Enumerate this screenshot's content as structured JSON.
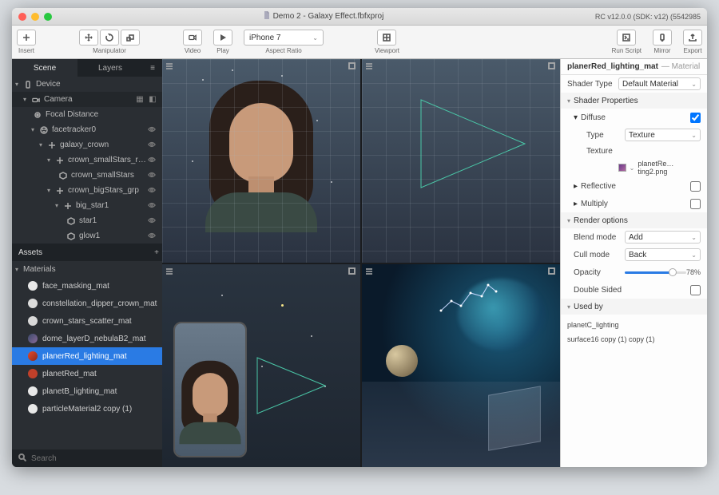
{
  "window": {
    "title": "Demo 2 - Galaxy Effect.fbfxproj",
    "version": "RC v12.0.0 (SDK: v12) (5542985"
  },
  "toolbar": {
    "insert": "Insert",
    "manipulator": "Manipulator",
    "video": "Video",
    "play": "Play",
    "aspect": "Aspect Ratio",
    "device_sel": "iPhone 7",
    "viewport": "Viewport",
    "run": "Run Script",
    "mirror": "Mirror",
    "export": "Export"
  },
  "left": {
    "tab_scene": "Scene",
    "tab_layers": "Layers",
    "device": "Device",
    "camera": "Camera",
    "focal": "Focal Distance",
    "facetracker": "facetracker0",
    "galaxy_crown": "galaxy_crown",
    "crown_small_rot": "crown_smallStars_rotate",
    "crown_small": "crown_smallStars",
    "crown_big_grp": "crown_bigStars_grp",
    "big_star1": "big_star1",
    "star1": "star1",
    "glow1": "glow1",
    "assets": "Assets",
    "materials": "Materials",
    "mats": [
      {
        "name": "face_masking_mat",
        "color": "#e8e8e8"
      },
      {
        "name": "constellation_dipper_crown_mat",
        "color": "#dcdcdc"
      },
      {
        "name": "crown_stars_scatter_mat",
        "color": "#d8d8d8"
      },
      {
        "name": "dome_layerD_nebulaB2_mat",
        "color": "linear"
      },
      {
        "name": "planerRed_lighting_mat",
        "color": "red"
      },
      {
        "name": "planetRed_mat",
        "color": "#c0402a"
      },
      {
        "name": "planetB_lighting_mat",
        "color": "#e8e8e8"
      },
      {
        "name": "particleMaterial2 copy (1)",
        "color": "#e8e8e8"
      }
    ],
    "search_placeholder": "Search"
  },
  "right": {
    "name": "planerRed_lighting_mat",
    "type": "— Material",
    "shader_type_k": "Shader Type",
    "shader_type_v": "Default Material",
    "shader_props": "Shader Properties",
    "diffuse": "Diffuse",
    "type_k": "Type",
    "type_v": "Texture",
    "texture_k": "Texture",
    "texture_v": "planetRe…ting2.png",
    "reflective": "Reflective",
    "multiply": "Multiply",
    "render_opts": "Render options",
    "blend_k": "Blend mode",
    "blend_v": "Add",
    "cull_k": "Cull mode",
    "cull_v": "Back",
    "opacity_k": "Opacity",
    "opacity_v": "78%",
    "double_sided": "Double Sided",
    "used_by": "Used by",
    "used1": "planetC_lighting",
    "used2": "surface16 copy (1) copy (1)"
  }
}
